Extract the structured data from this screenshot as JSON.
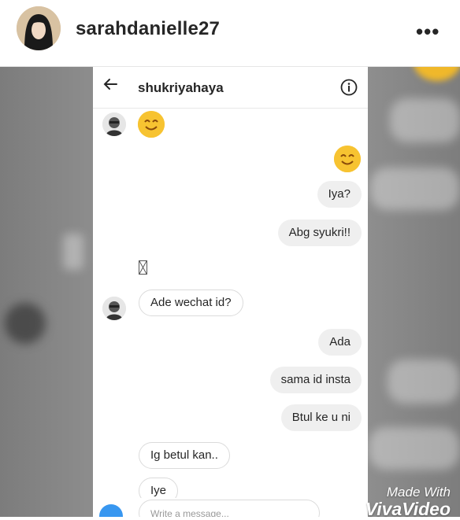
{
  "post": {
    "username": "sarahdanielle27",
    "more_label": "•••"
  },
  "chat": {
    "title": "shukriyahaya",
    "messages": [
      {
        "side": "in",
        "type": "emoji"
      },
      {
        "side": "out",
        "type": "emoji"
      },
      {
        "side": "out",
        "text": "Iya?"
      },
      {
        "side": "out",
        "text": "Abg syukri!!"
      },
      {
        "side": "in",
        "text": "Ade wechat id?"
      },
      {
        "side": "out",
        "text": "Ada"
      },
      {
        "side": "out",
        "text": "sama id insta"
      },
      {
        "side": "out",
        "text": "Btul ke u ni"
      },
      {
        "side": "in",
        "text": "Ig betul kan.."
      },
      {
        "side": "in",
        "text": "Iye"
      }
    ],
    "composer_placeholder": "Write a message..."
  },
  "watermark": {
    "line1": "Made With",
    "line2": "VivaVideo"
  },
  "colors": {
    "accent": "#3897f0",
    "emoji": "#f7c331",
    "bubble_out": "#efefef"
  }
}
